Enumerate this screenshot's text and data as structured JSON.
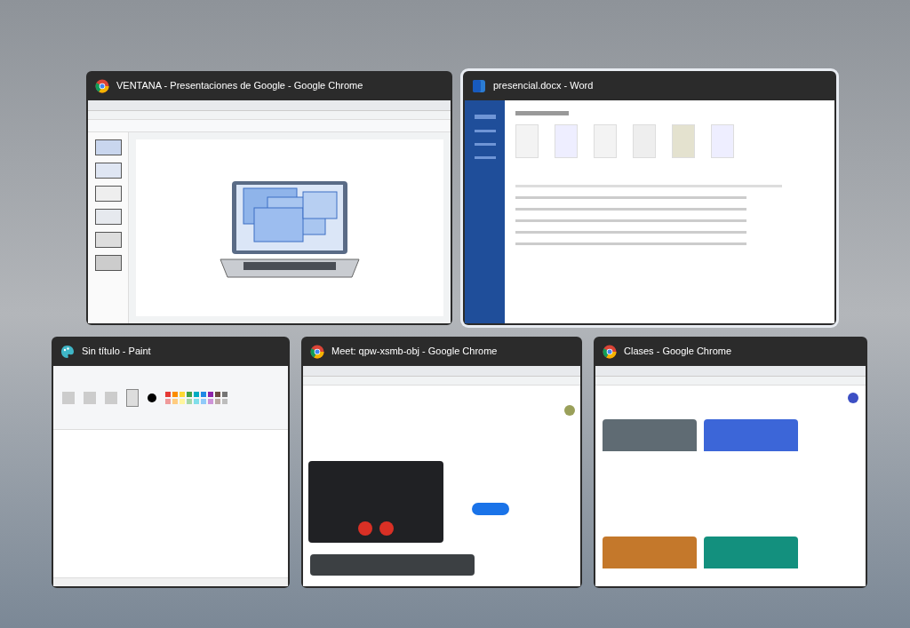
{
  "rows": [
    [
      {
        "title": "VENTANA - Presentaciones de Google - Google Chrome",
        "kind": "slides",
        "selected": false
      },
      {
        "title": "presencial.docx - Word",
        "kind": "word",
        "selected": true
      }
    ],
    [
      {
        "title": "Sin título - Paint",
        "kind": "paint",
        "selected": false
      },
      {
        "title": "Meet: qpw-xsmb-obj - Google Chrome",
        "kind": "meet",
        "selected": false
      },
      {
        "title": "Clases - Google Chrome",
        "kind": "classroom",
        "selected": false
      }
    ]
  ]
}
